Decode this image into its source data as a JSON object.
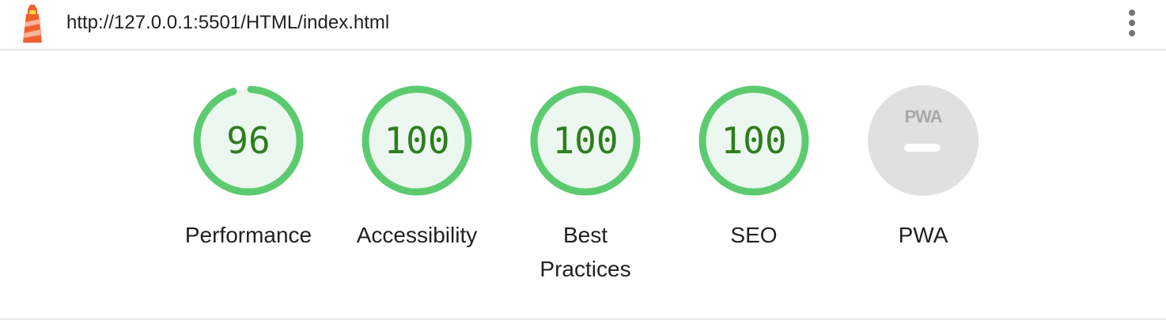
{
  "header": {
    "url": "http://127.0.0.1:5501/HTML/index.html",
    "logo_icon": "lighthouse-icon",
    "menu_icon": "more-vert-icon"
  },
  "colors": {
    "pass": "#5ccb70",
    "pass_fill": "#ecf8ef",
    "pass_text": "#2e7d1f",
    "na": "#e0e0e0",
    "text": "#212121"
  },
  "categories": [
    {
      "label": "Performance",
      "score": "96",
      "fraction": 0.96
    },
    {
      "label": "Accessibility",
      "score": "100",
      "fraction": 1.0
    },
    {
      "label": "Best Practices",
      "score": "100",
      "fraction": 1.0
    },
    {
      "label": "SEO",
      "score": "100",
      "fraction": 1.0
    }
  ],
  "pwa": {
    "label": "PWA",
    "badge_text": "PWA",
    "badge_icon": "pwa-badge-icon"
  }
}
